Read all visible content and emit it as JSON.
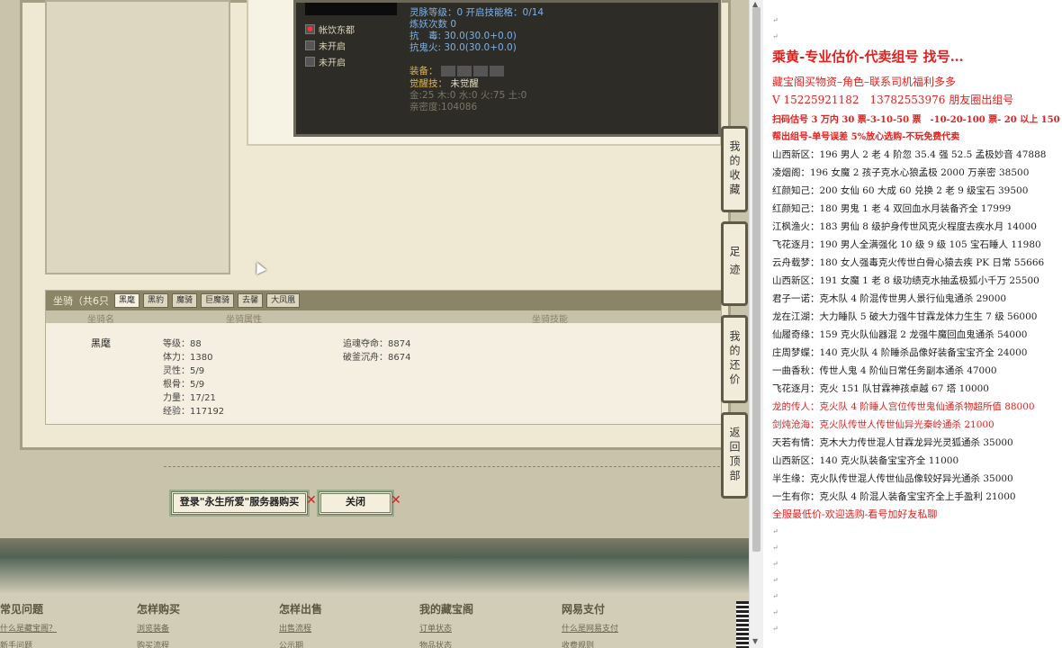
{
  "stats": {
    "line1": "灵脉等级：0 开启技能格：0/14",
    "line2": "炼妖次数 0",
    "line3": "抗　毒: 30.0(30.0+0.0)",
    "line4": "抗鬼火: 30.0(30.0+0.0)",
    "equip_label": "装备：",
    "awaken_label": "觉醒技：",
    "awaken_value": "未觉醒",
    "elements": "金:25 木:0 水:0 火:75 土:0",
    "intimacy": "亲密度:104086"
  },
  "skills": [
    {
      "name": "帐饮东都",
      "icon": "red-skill-icon"
    },
    {
      "name": "未开启",
      "icon": "locked-skill-icon"
    },
    {
      "name": "未开启",
      "icon": "locked-skill-icon"
    }
  ],
  "mount": {
    "header": "坐骑（共6只",
    "tabs": [
      "黑麾",
      "黑豹",
      "魔骑",
      "巨魔骑",
      "去馨",
      "大凤凰"
    ],
    "col_name": "坐骑名",
    "col_attr": "坐骑属性",
    "col_skill": "坐骑技能",
    "name": "黑麾",
    "attrs": [
      "等级：88",
      "体力：1380",
      "灵性：5/9",
      "根骨：5/9",
      "力量：17/21",
      "经验：117192"
    ],
    "skills": [
      "追魂夺命：8874",
      "破釜沉舟：8674"
    ]
  },
  "buttons": {
    "login_buy": "登录\"永生所爱\"服务器购买",
    "close": "关闭"
  },
  "side_buttons": [
    "我的收藏",
    "足迹",
    "我的还价",
    "返回顶部"
  ],
  "footer": [
    {
      "title": "常见问题",
      "links": [
        "什么是藏宝阁？",
        "新手问题"
      ]
    },
    {
      "title": "怎样购买",
      "links": [
        "浏览装备",
        "购买流程"
      ]
    },
    {
      "title": "怎样出售",
      "links": [
        "出售流程",
        "公示期"
      ]
    },
    {
      "title": "我的藏宝阁",
      "links": [
        "订单状态",
        "物品状态"
      ]
    },
    {
      "title": "网易支付",
      "links": [
        "什么是网易支付",
        "收费规则"
      ]
    }
  ],
  "notes": {
    "title": "乘黄-专业估价-代卖组号 找号…",
    "line1": "藏宝阁买物资–角色–联系司机福利多多",
    "line2": "V 15225921182　13782553976 朋友圈出组号",
    "line3": "扫码估号 3 万内 30 票-3-10-50 票　-10-20-100 票- 20 以上 150",
    "line4": "帮出组号-单号误差 5%放心选购-不玩免费代卖",
    "listings": [
      {
        "text": "山西新区：196 男人 2 老 4 阶忽 35.4 强 52.5 孟极妙音 47888",
        "red": false
      },
      {
        "text": "凌烟阁：196 女魔 2 孩子克水心狼孟极 2000 万亲密 38500",
        "red": false
      },
      {
        "text": "红颜知己：200 女仙 60 大成 60 兑换 2 老 9 级宝石 39500",
        "red": false
      },
      {
        "text": "红颜知己：180 男鬼 1 老 4 双回血水月装备齐全 17999",
        "red": false
      },
      {
        "text": "江枫渔火：183 男仙 8 级护身传世风克火程度去疾水月 14000",
        "red": false
      },
      {
        "text": "飞花逐月：190 男人全满强化 10 级 9 级 105 宝石睡人 11980",
        "red": false
      },
      {
        "text": "云舟载梦：180 女人强毒克火传世白骨心猿去疾 PK 日常 55666",
        "red": false
      },
      {
        "text": "山西新区：191 女魔 1 老 8 级功绩克水抽孟极狐小千万 25500",
        "red": false
      },
      {
        "text": "君子一诺：克木队 4 阶混传世男人景行仙鬼通杀 29000",
        "red": false
      },
      {
        "text": "龙在江湖：大力睡队 5 破大力强牛甘霖龙体力生生 7 级 56000",
        "red": false
      },
      {
        "text": "仙履奇缘：159 克火队仙器混 2 龙强牛魔回血鬼通杀 54000",
        "red": false
      },
      {
        "text": "庄周梦蝶：140 克火队 4 阶睡杀品像好装备宝宝齐全 24000",
        "red": false
      },
      {
        "text": "一曲香秋：传世人鬼 4 阶仙日常任务副本通杀 47000",
        "red": false
      },
      {
        "text": "飞花逐月：克火 151 队甘霖神孩卓越 67 塔 10000",
        "red": false
      },
      {
        "text": "龙的传人：克火队 4 阶睡人宫位传世鬼仙通杀物超所值 88000",
        "red": true
      },
      {
        "text": "剑炖沧海：克火队传世人传世仙异光秦岭通杀 21000",
        "red": true
      },
      {
        "text": "天若有情：克木大力传世混人甘霖龙异光灵狐通杀 35000",
        "red": false
      },
      {
        "text": "山西新区：140 克火队装备宝宝齐全 11000",
        "red": false
      },
      {
        "text": "半生缘：克火队传世混人传世仙品像较好异光通杀 35000",
        "red": false
      },
      {
        "text": "一生有你：克火队 4 阶混人装备宝宝齐全上手盈利 21000",
        "red": false
      }
    ],
    "closing": "全服最低价-欢迎选购-看号加好友私聊"
  },
  "colors": {
    "accent_red": "#e0211f",
    "stat_blue": "#7fb0e6",
    "gold": "#d8b45a"
  }
}
